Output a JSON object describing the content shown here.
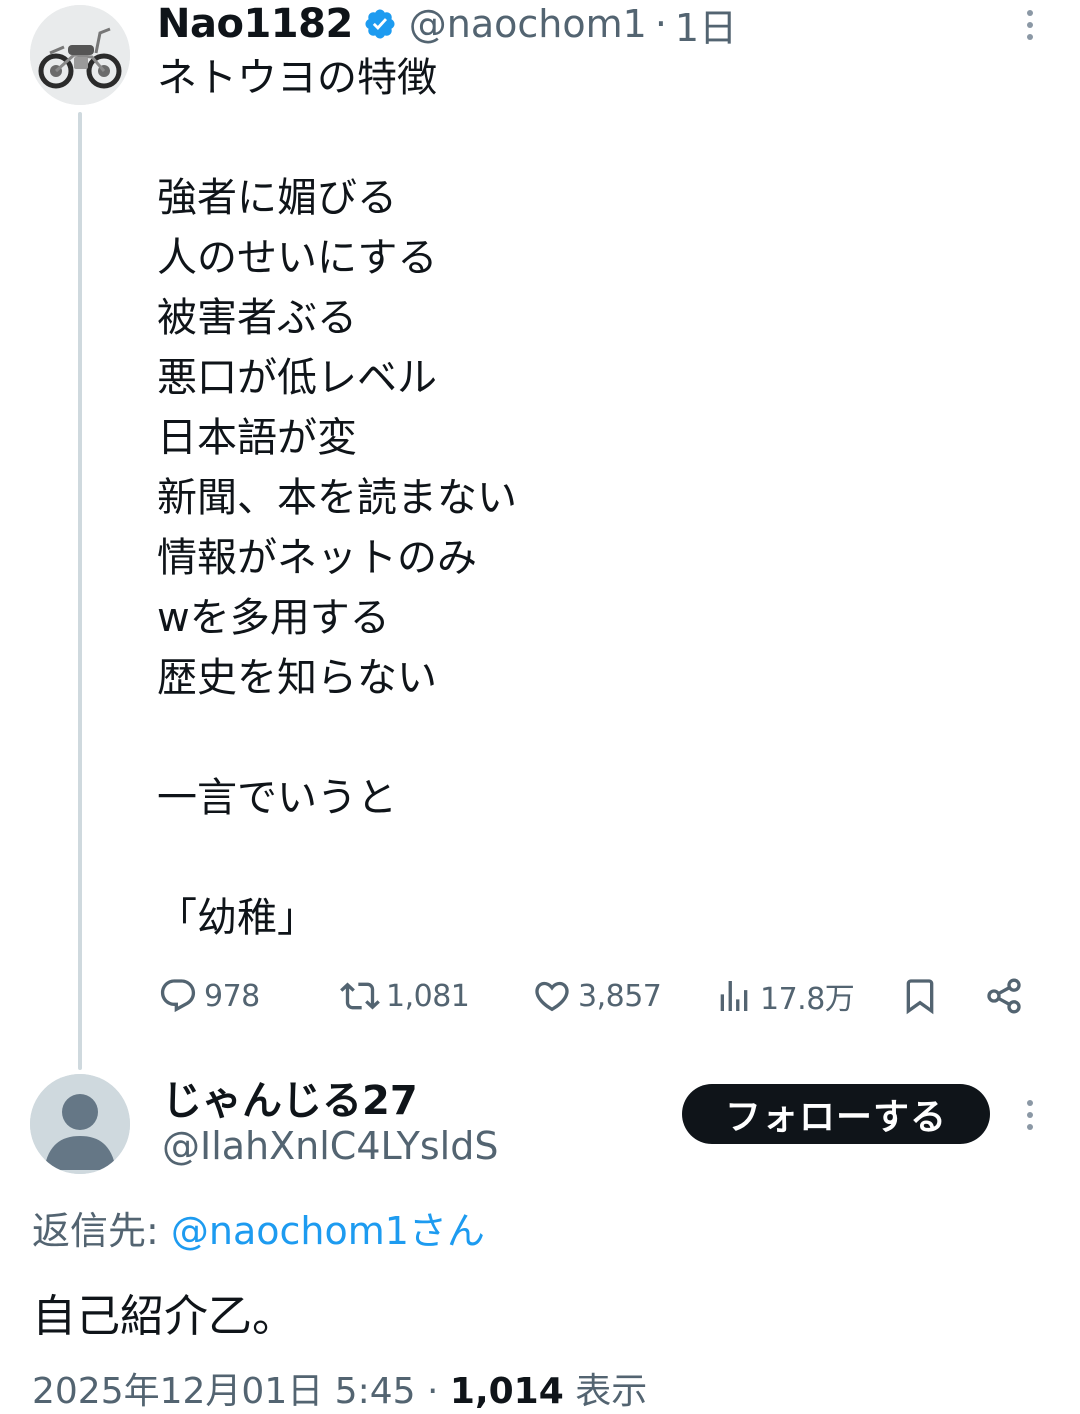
{
  "tweet": {
    "author_name": "Nao1182",
    "handle": "@naochom1",
    "separator": "·",
    "time": "1日",
    "lines": [
      "ネトウヨの特徴",
      "",
      "強者に媚びる",
      "人のせいにする",
      "被害者ぶる",
      "悪口が低レベル",
      "日本語が変",
      "新聞、本を読まない",
      "情報がネットのみ",
      "wを多用する",
      "歴史を知らない",
      "",
      "一言でいうと",
      "",
      "「幼稚」"
    ],
    "stats": {
      "replies": "978",
      "reposts": "1,081",
      "likes": "3,857",
      "views": "17.8万"
    },
    "icons": {
      "verified": "verified-badge-icon",
      "reply": "reply-icon",
      "repost": "repost-icon",
      "like": "heart-icon",
      "views": "views-icon",
      "bookmark": "bookmark-icon",
      "share": "share-icon",
      "more": "more-vertical-icon",
      "avatar": "motorcycle-avatar"
    }
  },
  "reply": {
    "author_name": "じゃんじる27",
    "handle": "@IlahXnlC4LYsldS",
    "follow_label": "フォローする",
    "replying_prefix": "返信先: ",
    "replying_to": "@naochom1さん",
    "text": "自己紹介乙。",
    "date": "2025年12月01日 5:45",
    "separator": "·",
    "views_count": "1,014",
    "views_label": "表示",
    "icons": {
      "avatar": "default-avatar",
      "more": "more-vertical-icon"
    }
  },
  "colors": {
    "text_primary": "#0f1419",
    "text_secondary": "#536471",
    "link": "#1d9bf0",
    "verified": "#1d9bf0",
    "thread_line": "#cfd9de",
    "follow_button_bg": "#0f1419"
  }
}
